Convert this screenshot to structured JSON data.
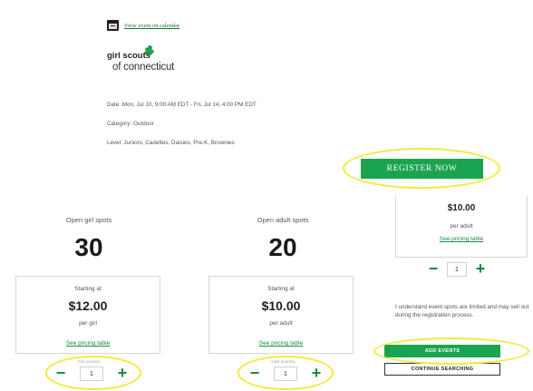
{
  "calendar": {
    "link_text": "View event on calendar"
  },
  "logo": {
    "line1": "girl scouts",
    "line2": "of connecticut"
  },
  "event": {
    "date": "Date: Mon, Jul 10, 9:00 AM EDT - Fri, Jul 14, 4:00 PM EDT",
    "category": "Category: Outdoor",
    "level": "Level: Juniors, Cadettes, Daisies, Pre-K, Brownies"
  },
  "register": {
    "label": "REGISTER NOW"
  },
  "girl_tickets": {
    "spots_label": "Open girl spots",
    "spots_count": "30",
    "starting_label": "Starting at",
    "price": "$12.00",
    "per_label": "per girl",
    "pricing_link": "See pricing table",
    "qty_caption": "Girl quantity",
    "quantity": "1"
  },
  "adult_tickets": {
    "spots_label": "Open adult spots",
    "spots_count": "20",
    "starting_label": "Starting at",
    "price": "$10.00",
    "per_label": "per adult",
    "pricing_link": "See pricing table",
    "qty_caption": "Adult quantity",
    "quantity": "1"
  },
  "right_panel": {
    "price": "$10.00",
    "per_label": "per adult",
    "pricing_link": "See pricing table",
    "quantity": "1",
    "terms": "I understand event spots are limited and may sell out during the registration process.",
    "add_button": "ADD EVENTS",
    "continue_button": "CONTINUE SEARCHING"
  },
  "stepper_icons": {
    "minus": "−",
    "plus": "+"
  },
  "colors": {
    "brand_green": "#1aa450",
    "link_green": "#1a8a43",
    "highlight": "#f2ea3a"
  }
}
